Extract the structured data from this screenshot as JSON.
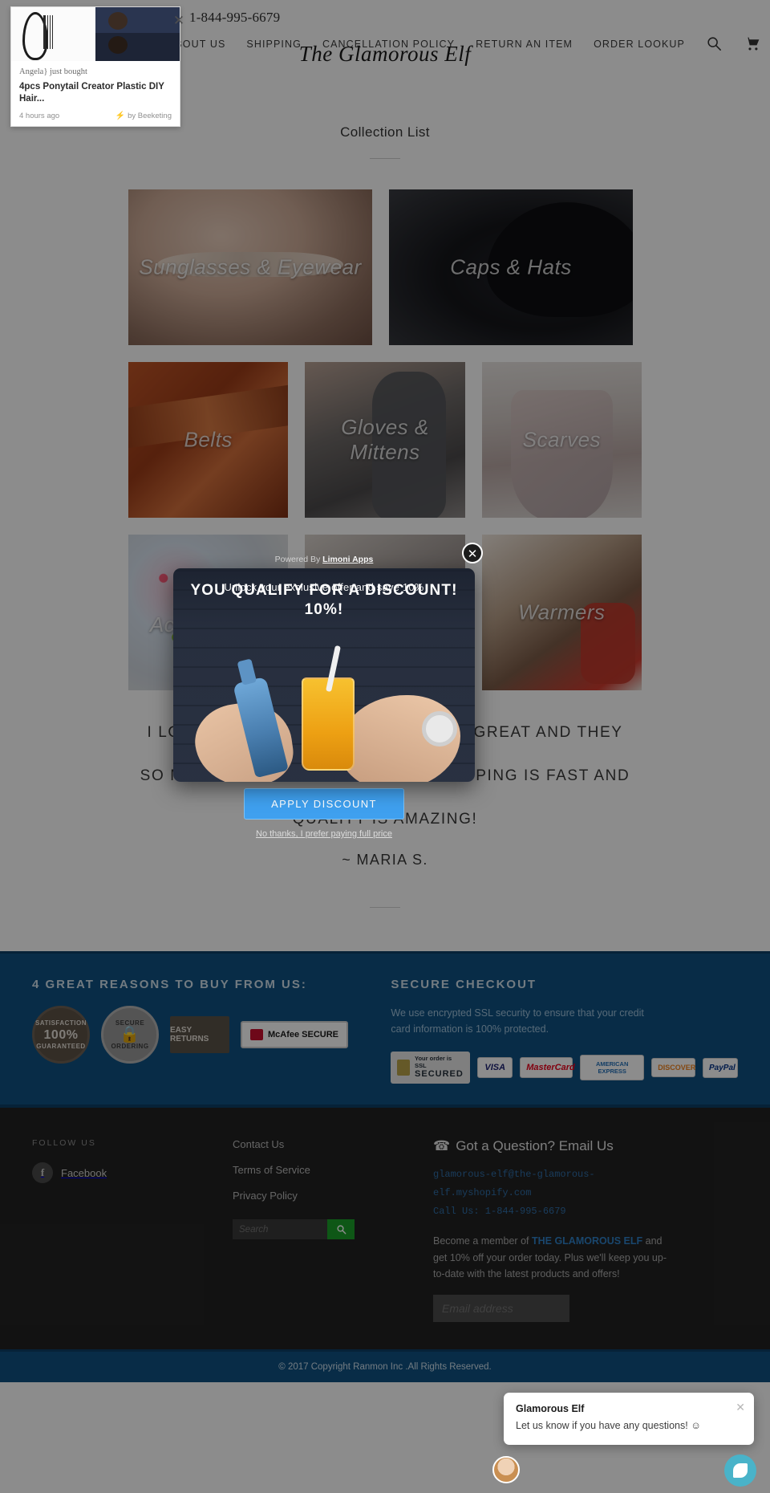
{
  "header": {
    "phone": "1-844-995-6679",
    "logo": "The Glamorous Elf",
    "nav": [
      {
        "label": "ABOUT US"
      },
      {
        "label": "SHIPPING"
      },
      {
        "label": "CANCELLATION POLICY"
      },
      {
        "label": "RETURN AN ITEM"
      },
      {
        "label": "ORDER LOOKUP"
      }
    ],
    "search_icon": "search-icon",
    "cart_icon": "cart-icon"
  },
  "main": {
    "section_title": "Collection List",
    "collections": [
      {
        "label": "Sunglasses & Eyewear",
        "style": "ph-sun"
      },
      {
        "label": "Caps & Hats",
        "style": "ph-caps"
      },
      {
        "label": "Belts",
        "style": "ph-belts"
      },
      {
        "label": "Gloves & Mittens",
        "style": "ph-gloves"
      },
      {
        "label": "Scarves",
        "style": "ph-scarves"
      },
      {
        "label": "Hair Accessories",
        "style": "ph-hair"
      },
      {
        "label": "",
        "style": "ph-mid"
      },
      {
        "label": "Warmers",
        "style": "ph-warm"
      }
    ],
    "quote_line1": "I LOVE THIS STORE! THE PRICES ARE GREAT AND THEY HAVE",
    "quote_line2": "SO MUCH TO CHOOSE FROM. THE SHIPPING IS FAST AND THE",
    "quote_line3": "QUALITY IS AMAZING!",
    "quote_attrib": "~ MARIA S."
  },
  "trust": {
    "reasons_heading": "4 GREAT REASONS TO BUY FROM US:",
    "badges": [
      {
        "name": "satisfaction-guaranteed-badge",
        "top": "SATISFACTION",
        "big": "100%",
        "bottom": "GUARANTEED"
      },
      {
        "name": "secure-ordering-badge",
        "top": "SECURE",
        "big": "",
        "bottom": "ORDERING"
      },
      {
        "name": "easy-returns-badge",
        "label": "EASY RETURNS"
      },
      {
        "name": "mcafee-secure-badge",
        "label": "McAfee SECURE"
      }
    ],
    "secure_heading": "SECURE CHECKOUT",
    "secure_text": "We use encrypted SSL security to ensure that your credit card information is 100% protected.",
    "ssl_line1": "Your order is SSL",
    "ssl_line2": "SECURED",
    "payments": [
      "VISA",
      "MasterCard",
      "AMERICAN EXPRESS",
      "DISCOVER",
      "PayPal"
    ]
  },
  "footer": {
    "follow_heading": "FOLLOW US",
    "facebook": "Facebook",
    "links": [
      {
        "label": "Contact Us"
      },
      {
        "label": "Terms of Service"
      },
      {
        "label": "Privacy Policy"
      }
    ],
    "search_placeholder": "Search",
    "question_title": "Got a Question? Email Us",
    "email_line1": "glamorous-elf@the-glamorous-",
    "email_line2": "elf.myshopify.com",
    "call_line": "Call Us: 1-844-995-6679",
    "newsletter_pre": "Become a member of ",
    "newsletter_link": "THE GLAMOROUS ELF",
    "newsletter_post": " and get 10% off your order today. Plus we'll keep you up-to-date with the latest products and offers!",
    "email_placeholder": "Email address",
    "copyright": "© 2017 Copyright Ranmon Inc .All Rights Reserved."
  },
  "sales_popup": {
    "who": "Angela} just bought",
    "product": "4pcs Ponytail Creator Plastic DIY Hair...",
    "time": "4 hours ago",
    "brand": "by Beeketing",
    "close_icon": "close-icon"
  },
  "discount_modal": {
    "powered_by_pre": "Powered By ",
    "powered_by_brand": "Limoni Apps",
    "subtext": "Unlock your exclusive offer and save 10%",
    "headline": "YOU QUALIFY FOR A DISCOUNT!",
    "headline_line2": "10%!",
    "apply_label": "APPLY DISCOUNT",
    "decline_label": "No thanks, I prefer paying full price",
    "close_icon": "close-icon",
    "accent": "#3fa0ef"
  },
  "chat": {
    "title": "Glamorous Elf",
    "message": "Let us know if you have any questions! ☺",
    "close_icon": "close-icon",
    "launcher_icon": "chat-icon"
  }
}
